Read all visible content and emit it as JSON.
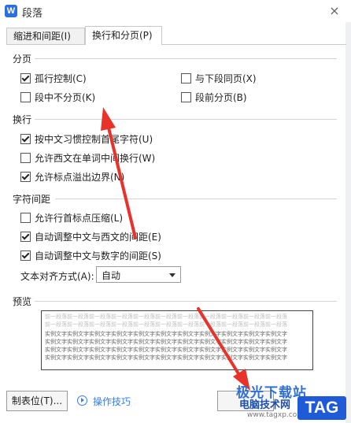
{
  "window": {
    "title": "段落",
    "logo_letter": "W",
    "close": "×"
  },
  "tabs": [
    {
      "label": "缩进和间距(I)",
      "active": false
    },
    {
      "label": "换行和分页(P)",
      "active": true
    }
  ],
  "groups": {
    "pagination": {
      "title": "分页",
      "items": [
        {
          "label": "孤行控制(C)",
          "checked": true
        },
        {
          "label": "与下段同页(X)",
          "checked": false
        },
        {
          "label": "段中不分页(K)",
          "checked": false
        },
        {
          "label": "段前分页(B)",
          "checked": false
        }
      ]
    },
    "linebreak": {
      "title": "换行",
      "items": [
        {
          "label": "按中文习惯控制首尾字符(U)",
          "checked": true
        },
        {
          "label": "允许西文在单词中间换行(W)",
          "checked": false
        },
        {
          "label": "允许标点溢出边界(N)",
          "checked": true
        }
      ]
    },
    "spacing": {
      "title": "字符间距",
      "items": [
        {
          "label": "允许行首标点压缩(L)",
          "checked": false
        },
        {
          "label": "自动调整中文与西文的间距(E)",
          "checked": true
        },
        {
          "label": "自动调整中文与数字的间距(S)",
          "checked": true
        }
      ],
      "align_label": "文本对齐方式(A):",
      "align_value": "自动"
    },
    "preview": {
      "title": "预览",
      "prev_text": "前一段落前一段落前一段落前一段落前一段落前一段落前一段落前一段落前一段落前一段落前一段落",
      "sample_text": "实例文字实例文字实例文字实例文字实例文字实例文字实例文字实例文字实例文字实例文字实例文字"
    }
  },
  "footer": {
    "tabstop_label": "制表位(T)...",
    "tips_label": "操作技巧"
  },
  "watermark": {
    "line1": "极光下载站",
    "line2": "电脑技术网",
    "line3": "www.tagxp.com",
    "tag": "TAG"
  },
  "colors": {
    "link": "#3a7be8",
    "annotation_arrow": "#e8332a",
    "watermark_tag": "#1f5bd6"
  }
}
